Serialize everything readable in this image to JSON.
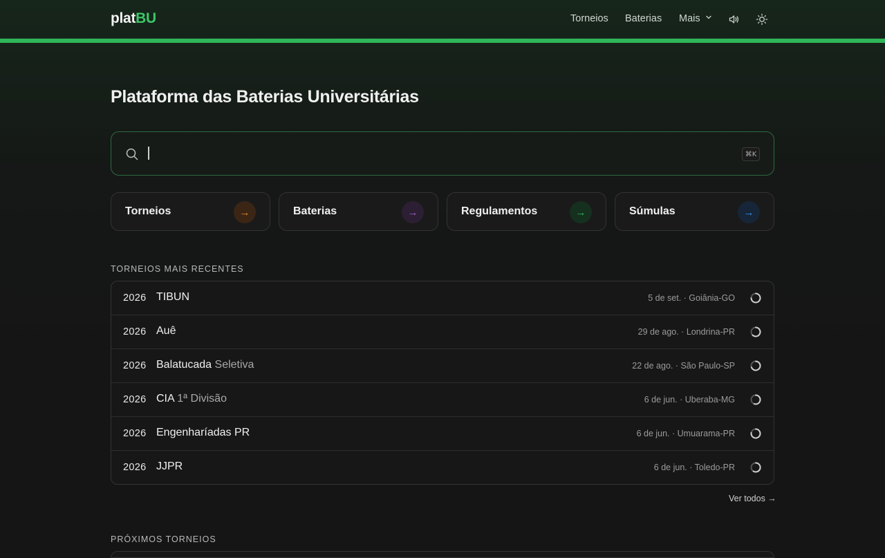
{
  "header": {
    "logo_part1": "plat",
    "logo_part2": "BU",
    "nav": {
      "torneios": "Torneios",
      "baterias": "Baterias",
      "mais": "Mais"
    },
    "icons": [
      "speaker-icon",
      "sun-icon"
    ]
  },
  "colors": {
    "accent": "#2fb65a",
    "logo_accent": "#3cc768",
    "background": "#151515",
    "torneios_arrow": "#e8872b",
    "baterias_arrow": "#a35bc9",
    "regulamentos_arrow": "#2fb65a",
    "sumulas_arrow": "#3a8fe6"
  },
  "main": {
    "title": "Plataforma das Baterias Universitárias",
    "search": {
      "placeholder": "",
      "value": "",
      "shortcut": "⌘K"
    },
    "quick_links": [
      {
        "label": "Torneios",
        "icon": "arrow-right-icon"
      },
      {
        "label": "Baterias",
        "icon": "arrow-right-icon"
      },
      {
        "label": "Regulamentos",
        "icon": "arrow-right-icon"
      },
      {
        "label": "Súmulas",
        "icon": "arrow-right-icon"
      }
    ],
    "recent_section": {
      "label": "TORNEIOS MAIS RECENTES",
      "items": [
        {
          "year": "2026",
          "name": "TIBUN",
          "sub": "",
          "meta": "5 de set. · Goiânia-GO"
        },
        {
          "year": "2026",
          "name": "Auê",
          "sub": "",
          "meta": "29 de ago. · Londrina-PR"
        },
        {
          "year": "2026",
          "name": "Balatucada",
          "sub": "Seletiva",
          "meta": "22 de ago. · São Paulo-SP"
        },
        {
          "year": "2026",
          "name": "CIA",
          "sub": "1ª Divisão",
          "meta": "6 de jun. · Uberaba-MG"
        },
        {
          "year": "2026",
          "name": "Engenharíadas PR",
          "sub": "",
          "meta": "6 de jun. · Umuarama-PR"
        },
        {
          "year": "2026",
          "name": "JJPR",
          "sub": "",
          "meta": "6 de jun. · Toledo-PR"
        }
      ],
      "see_all": "Ver todos →"
    },
    "upcoming_section": {
      "label": "PRÓXIMOS TORNEIOS"
    }
  }
}
